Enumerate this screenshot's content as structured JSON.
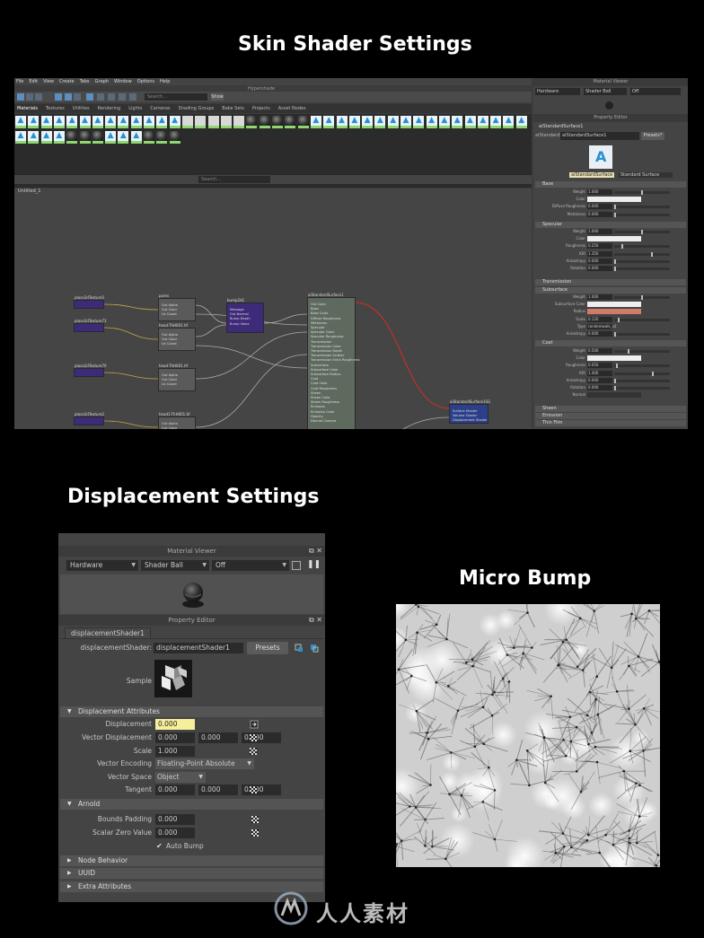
{
  "headings": {
    "skin": "Skin Shader Settings",
    "displacement": "Displacement Settings",
    "micro": "Micro Bump"
  },
  "hypershade": {
    "title": "Hypershade",
    "menus": [
      "File",
      "Edit",
      "View",
      "Create",
      "Tabs",
      "Graph",
      "Window",
      "Options",
      "Help"
    ],
    "search_placeholder": "Search...",
    "show_label": "Show",
    "tabs": [
      "Materials",
      "Textures",
      "Utilities",
      "Rendering",
      "Lights",
      "Cameras",
      "Shading Groups",
      "Bake Sets",
      "Projects",
      "Asset Nodes"
    ],
    "graph_tab": "Untitled_1",
    "graph_search": "Search...",
    "nodes": {
      "place1": "place2dTexture5",
      "place2": "place2dTexture73",
      "place3": "place2dTexture70",
      "place4": "place2dTexture2",
      "place5": "place2dTexture1",
      "file1": "pores",
      "file2": "head-ThH001.tif",
      "file3": "head-ThH001.tif",
      "file4": "head1-ThH001.tif",
      "file5": "head-LthH001.exr",
      "bump": "bump2d1",
      "bump_ports": [
        "Message",
        "Out Normal",
        "Bump Depth",
        "Bump Value"
      ],
      "file_ports": [
        "Out Alpha",
        "Out Color",
        "Uv Coord"
      ],
      "ai": "aiStandardSurface1",
      "ai_ports": [
        "Out Color",
        "Base",
        "Base Color",
        "Diffuse Roughness",
        "Metalness",
        "Specular",
        "Specular Color",
        "Specular Roughness",
        "Transmission",
        "Transmission Color",
        "Transmission Depth",
        "Transmission Scatter",
        "Transmission Extra Roughness",
        "Subsurface",
        "Subsurface Color",
        "Subsurface Radius",
        "Coat",
        "Coat Color",
        "Coat Roughness",
        "Sheen",
        "Sheen Color",
        "Sheen Roughness",
        "Emission",
        "Emission Color",
        "Opacity",
        "Normal Camera"
      ],
      "disp": "displacementShader1",
      "disp_ports": [
        "Displacement",
        "Vector Displacement",
        "Tangent"
      ],
      "sg": "aiStandardSurface1SG",
      "sg_ports": [
        "Surface Shader",
        "Volume Shader",
        "Displacement Shader"
      ]
    },
    "right": {
      "viewer_title": "Material Viewer",
      "renderer": "Hardware",
      "shape": "Shader Ball",
      "env": "Off",
      "pe_title": "Property Editor",
      "node_tab": "aiStandardSurface1",
      "field_label": "aiStandardSurface:",
      "field_value": "aiStandardSurface1",
      "presets": "Presets*",
      "type_label": "aiStandardSurface",
      "type_select": "Standard Surface",
      "sections": {
        "base": "Base",
        "specular": "Specular",
        "transmission": "Transmission",
        "subsurface": "Subsurface",
        "coat": "Coat",
        "sheen": "Sheen",
        "emission": "Emission",
        "thin": "Thin Film"
      },
      "base_attrs": [
        {
          "label": "Weight",
          "value": "1.000"
        },
        {
          "label": "Color",
          "value": ""
        },
        {
          "label": "Diffuse Roughness",
          "value": "0.000"
        },
        {
          "label": "Metalness",
          "value": "0.000"
        }
      ],
      "spec_attrs": [
        {
          "label": "Weight",
          "value": "1.000"
        },
        {
          "label": "Color",
          "value": ""
        },
        {
          "label": "Roughness",
          "value": "0.250"
        },
        {
          "label": "IOR",
          "value": "1.350"
        },
        {
          "label": "Anisotropy",
          "value": "0.000"
        },
        {
          "label": "Rotation",
          "value": "0.000"
        }
      ],
      "sss_attrs": [
        {
          "label": "Weight",
          "value": "1.000"
        },
        {
          "label": "Subsurface Color",
          "value": ""
        },
        {
          "label": "Radius",
          "value": ""
        },
        {
          "label": "Scale",
          "value": "0.120"
        },
        {
          "label": "Type",
          "value": "randomwalk_v2"
        },
        {
          "label": "Anisotropy",
          "value": "0.000"
        }
      ],
      "coat_attrs": [
        {
          "label": "Weight",
          "value": "0.500"
        },
        {
          "label": "Color",
          "value": ""
        },
        {
          "label": "Roughness",
          "value": "0.050"
        },
        {
          "label": "IOR",
          "value": "1.400"
        },
        {
          "label": "Anisotropy",
          "value": "0.000"
        },
        {
          "label": "Rotation",
          "value": "0.000"
        },
        {
          "label": "Normal",
          "value": ""
        }
      ]
    }
  },
  "panel": {
    "material_viewer_title": "Material Viewer",
    "renderer": "Hardware",
    "shape": "Shader Ball",
    "environment": "Off",
    "property_editor_title": "Property Editor",
    "node_tab": "displacementShader1",
    "shader_label": "displacementShader:",
    "shader_value": "displacementShader1",
    "presets_label": "Presets",
    "sample_label": "Sample",
    "section_displacement": "Displacement Attributes",
    "displacement_label": "Displacement",
    "displacement_value": "0.000",
    "vector_disp_label": "Vector Displacement",
    "vector_disp_values": [
      "0.000",
      "0.000",
      "0.000"
    ],
    "scale_label": "Scale",
    "scale_value": "1.000",
    "vector_encoding_label": "Vector Encoding",
    "vector_encoding_value": "Floating-Point Absolute",
    "vector_space_label": "Vector Space",
    "vector_space_value": "Object",
    "tangent_label": "Tangent",
    "tangent_values": [
      "0.000",
      "0.000",
      "0.000"
    ],
    "section_arnold": "Arnold",
    "bounds_padding_label": "Bounds Padding",
    "bounds_padding_value": "0.000",
    "scalar_zero_label": "Scalar Zero Value",
    "scalar_zero_value": "0.000",
    "auto_bump_label": "Auto Bump",
    "section_node_behavior": "Node Behavior",
    "section_uuid": "UUID",
    "section_extra": "Extra Attributes"
  },
  "watermark": "人人素材",
  "colors": {
    "accent_blue": "#5b8fbf",
    "highlight_field": "#f5ee9a",
    "connection_red": "#c0302a",
    "connection_yellow": "#c8a840",
    "node_purple": "#3d2a78",
    "node_blue": "#2b3f8a"
  }
}
